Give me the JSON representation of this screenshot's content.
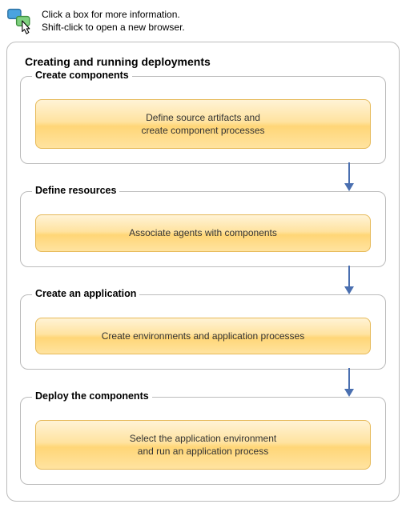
{
  "hint": {
    "line1": "Click a box for more information.",
    "line2": "Shift-click to open a new browser."
  },
  "main_title": "Creating and running deployments",
  "stages": {
    "s1": {
      "title": "Create components",
      "action_l1": "Define source artifacts and",
      "action_l2": "create component processes"
    },
    "s2": {
      "title": "Define resources",
      "action_l1": "Associate agents with components",
      "action_l2": ""
    },
    "s3": {
      "title": "Create an application",
      "action_l1": "Create environments and application processes",
      "action_l2": ""
    },
    "s4": {
      "title": "Deploy the components",
      "action_l1": "Select the application environment",
      "action_l2": "and run an application process"
    }
  }
}
